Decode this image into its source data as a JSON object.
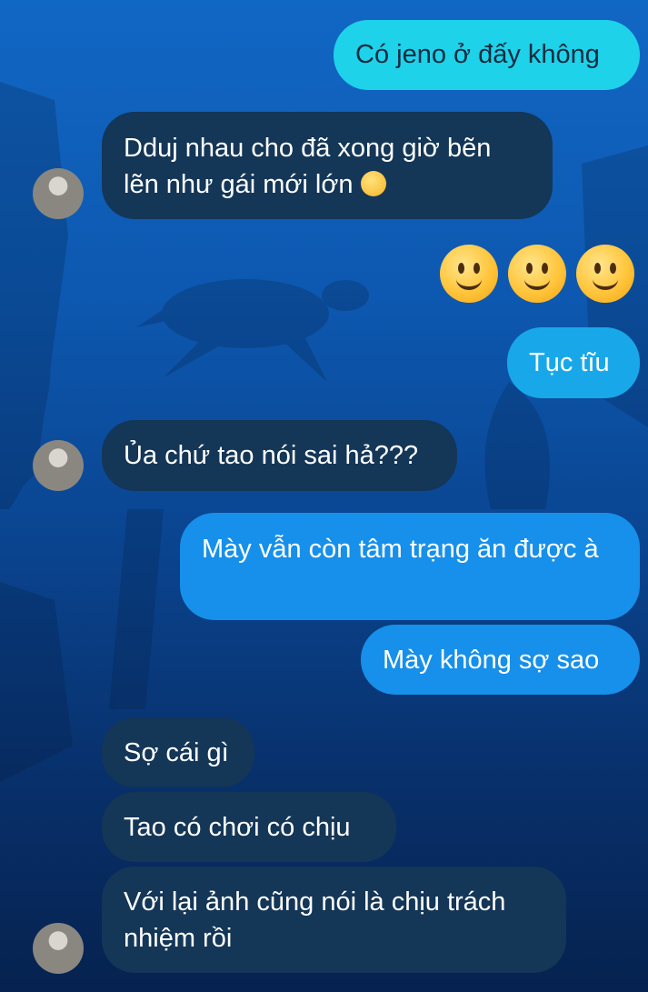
{
  "messages": [
    {
      "direction": "outgoing",
      "text": "Có jeno ở đấy không"
    },
    {
      "direction": "incoming",
      "text": "Dduj nhau cho đã xong giờ bẽn lẽn như gái mới lớn",
      "emoji": "upside-down-face"
    },
    {
      "direction": "outgoing",
      "type": "emoji",
      "emojis": [
        "slightly-smiling-face",
        "slightly-smiling-face",
        "slightly-smiling-face"
      ]
    },
    {
      "direction": "outgoing",
      "text": "Tục tĩu"
    },
    {
      "direction": "incoming",
      "text": "Ủa chứ tao nói sai hả???"
    },
    {
      "direction": "outgoing",
      "text": "Mày vẫn còn tâm trạng ăn được à"
    },
    {
      "direction": "outgoing",
      "text": "Mày không sợ sao"
    },
    {
      "direction": "incoming",
      "text": "Sợ cái gì"
    },
    {
      "direction": "incoming",
      "text": "Tao có chơi có chịu"
    },
    {
      "direction": "incoming",
      "text": "Với lại ảnh cũng nói là chịu trách nhiệm rồi"
    }
  ],
  "colors": {
    "outgoing_top": "#1ed2ea",
    "outgoing_mid": "#18a8ea",
    "outgoing_bottom": "#1690ea",
    "incoming": "#143657"
  }
}
